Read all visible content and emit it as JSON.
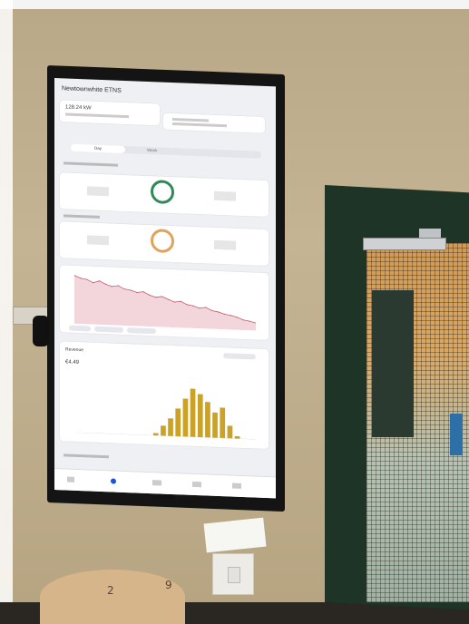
{
  "screen": {
    "title": "Newtownwhite ETNS",
    "header_card": {
      "value": "128.24",
      "unit": "kW",
      "sub": ""
    },
    "header_card_right": {
      "line1": "",
      "line2": ""
    },
    "tabs": {
      "active": "Day",
      "others": [
        "Week",
        "",
        ""
      ]
    },
    "section_energy": {
      "label": "",
      "sub": ""
    },
    "ring_generation": {
      "value": ""
    },
    "section_consumption": {
      "label": ""
    },
    "ring_consumption": {
      "value": ""
    },
    "section_revenue": {
      "label": "Revenue",
      "sub": "",
      "value": "€4.49"
    },
    "bottom_label": "",
    "nav": {
      "items": [
        "",
        "",
        "",
        "",
        ""
      ]
    }
  },
  "chart_data": [
    {
      "type": "line",
      "title": "",
      "series": [
        {
          "values": [
            0.95,
            0.9,
            0.88,
            0.82,
            0.86,
            0.8,
            0.76,
            0.78,
            0.72,
            0.7,
            0.66,
            0.68,
            0.62,
            0.58,
            0.6,
            0.55,
            0.5,
            0.52,
            0.46,
            0.44,
            0.4,
            0.42,
            0.36,
            0.34,
            0.3,
            0.28,
            0.25,
            0.2,
            0.18,
            0.15
          ]
        }
      ]
    },
    {
      "type": "bar",
      "title": "",
      "values": [
        0,
        0,
        0,
        0,
        0,
        0,
        0,
        0,
        0,
        0,
        0.05,
        0.2,
        0.35,
        0.55,
        0.75,
        0.95,
        0.85,
        0.7,
        0.5,
        0.6,
        0.25,
        0.05,
        0,
        0
      ]
    }
  ],
  "wall": {
    "clock_numbers": [
      "2",
      "9"
    ]
  },
  "colors": {
    "accent_green": "#2e8b57",
    "accent_orange": "#e0a35a",
    "bar_gold": "#c9a227",
    "line_red": "#c06070"
  }
}
